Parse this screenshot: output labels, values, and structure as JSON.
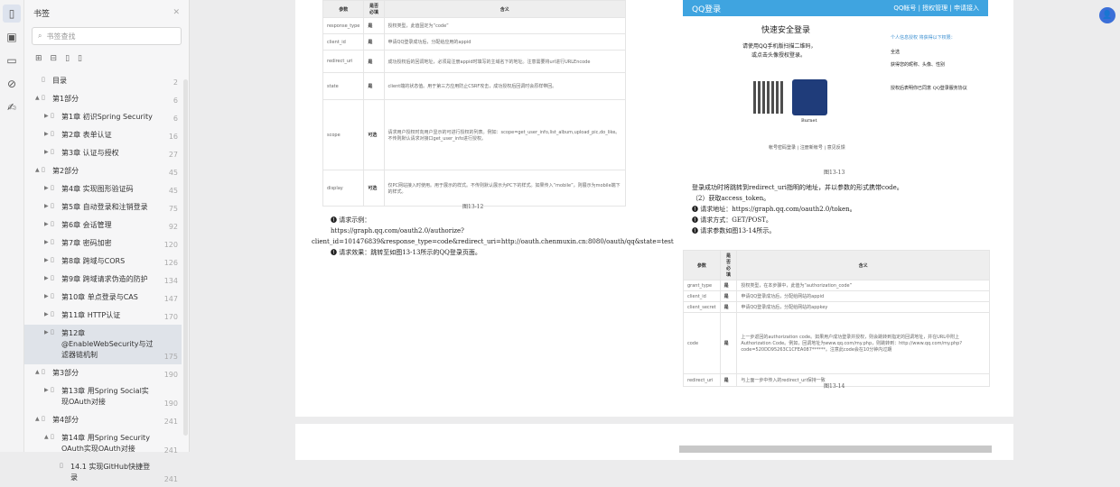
{
  "rail": {
    "icons": [
      "bookmark-icon",
      "thumbnail-icon",
      "comment-icon",
      "attachment-icon",
      "signature-icon"
    ]
  },
  "sidebar": {
    "title": "书签",
    "search_placeholder": "书签查找",
    "items": [
      {
        "label": "目录",
        "page": "2",
        "level": 0,
        "arrow": ""
      },
      {
        "label": "第1部分",
        "page": "6",
        "level": 0,
        "arrow": "▲"
      },
      {
        "label": "第1章 初识Spring Security",
        "page": "6",
        "level": 1,
        "arrow": "▶"
      },
      {
        "label": "第2章 表单认证",
        "page": "16",
        "level": 1,
        "arrow": "▶"
      },
      {
        "label": "第3章 认证与授权",
        "page": "27",
        "level": 1,
        "arrow": "▶"
      },
      {
        "label": "第2部分",
        "page": "45",
        "level": 0,
        "arrow": "▲"
      },
      {
        "label": "第4章 实现图形验证码",
        "page": "45",
        "level": 1,
        "arrow": "▶"
      },
      {
        "label": "第5章 自动登录和注销登录",
        "page": "75",
        "level": 1,
        "arrow": "▶"
      },
      {
        "label": "第6章 会话管理",
        "page": "92",
        "level": 1,
        "arrow": "▶"
      },
      {
        "label": "第7章 密码加密",
        "page": "120",
        "level": 1,
        "arrow": "▶"
      },
      {
        "label": "第8章 跨域与CORS",
        "page": "126",
        "level": 1,
        "arrow": "▶"
      },
      {
        "label": "第9章 跨域请求伪造的防护",
        "page": "134",
        "level": 1,
        "arrow": "▶"
      },
      {
        "label": "第10章 单点登录与CAS",
        "page": "147",
        "level": 1,
        "arrow": "▶"
      },
      {
        "label": "第11章 HTTP认证",
        "page": "170",
        "level": 1,
        "arrow": "▶"
      },
      {
        "label": "第12章 @EnableWebSecurity与过滤器链机制",
        "page": "175",
        "level": 1,
        "arrow": "▶",
        "selected": true
      },
      {
        "label": "第3部分",
        "page": "190",
        "level": 0,
        "arrow": "▲"
      },
      {
        "label": "第13章 用Spring Social实现OAuth对接",
        "page": "190",
        "level": 1,
        "arrow": "▶"
      },
      {
        "label": "第4部分",
        "page": "241",
        "level": 0,
        "arrow": "▲"
      },
      {
        "label": "第14章 用Spring Security OAuth实现OAuth对接",
        "page": "241",
        "level": 1,
        "arrow": "▲"
      },
      {
        "label": "14.1 实现GitHub快捷登录",
        "page": "241",
        "level": 2,
        "arrow": ""
      }
    ]
  },
  "left_page": {
    "table": {
      "headers": [
        "参数",
        "是否必填",
        "含义"
      ],
      "rows": [
        [
          "response_type",
          "是",
          "授权类型，此值固定为“code”"
        ],
        [
          "client_id",
          "是",
          "申请QQ登录成功后，分配给应用的appid"
        ],
        [
          "redirect_uri",
          "是",
          "成功授权后的回调地址，必须是注册appid时填写的主域名下的地址。注意需要将url进行URLEncode"
        ],
        [
          "state",
          "是",
          "client端的状态值。用于第三方应用防止CSRF攻击，成功授权后回调时会原样带回。"
        ],
        [
          "scope",
          "可选",
          "请求用户授权时向用户显示的可进行授权的列表。例如：scope=get_user_info,list_album,upload_pic,do_like。不传则默认请求对接口get_user_info进行授权。"
        ],
        [
          "display",
          "可选",
          "仅PC网站接入时使用。用于展示的样式。不传则默认展示为PC下的样式。如果传入“mobile”，则展示为mobile端下的样式。"
        ]
      ]
    },
    "caption": "图13-12",
    "lines": [
      "❶ 请求示例：",
      "https://graph.qq.com/oauth2.0/authorize?",
      "client_id=101476839&response_type=code&redirect_uri=http://oauth.chenmuxin.cn:8080/oauth/qq&state=test",
      "❶ 请求效果：跳转至如图13-13所示的QQ登录页面。"
    ]
  },
  "right_page": {
    "qq": {
      "brand": "QQ登录",
      "links": "QQ帐号 | 授权管理 | 申请接入",
      "title": "快速安全登录",
      "sub1": "请使用QQ手机版扫描二维码，",
      "sub2": "或点击头像授权登录。",
      "user": "Burnet",
      "footer": "帐号密码登录 | 注册新帐号 | 意见反馈",
      "side1": "个人信息授权 将获得以下权限：",
      "side2": "全选",
      "side3": "获得您的昵称、头像、性别",
      "side4": "授权后表明你已同意 QQ登录服务协议"
    },
    "caption1": "图13-13",
    "lines": [
      "登录成功时将跳转到redirect_uri指明的地址，并以参数的形式携带code。",
      "（2）获取access_token。",
      "❶ 请求地址：https://graph.qq.com/oauth2.0/token。",
      "❶ 请求方式：GET/POST。",
      "❶ 请求参数如图13-14所示。"
    ],
    "table": {
      "headers": [
        "参数",
        "是否必填",
        "含义"
      ],
      "rows": [
        [
          "grant_type",
          "是",
          "授权类型，在本步骤中，此值为“authorization_code”"
        ],
        [
          "client_id",
          "是",
          "申请QQ登录成功后，分配给网站的appid"
        ],
        [
          "client_secret",
          "是",
          "申请QQ登录成功后，分配给网站的appkey"
        ],
        [
          "code",
          "是",
          "上一步返回的authorization code。如果用户成功登录并授权，则会跳转到指定的回调地址，并在URL中附上Authorization Code。例如，回调地址为www.qq.com/my.php，则跳转到：http://www.qq.com/my.php?code=520DD95263C1CFEA087******。注意此code会在10分钟内过期"
        ],
        [
          "redirect_uri",
          "是",
          "与上面一步中传入的redirect_uri保持一致"
        ]
      ]
    },
    "caption2": "图13-14"
  }
}
